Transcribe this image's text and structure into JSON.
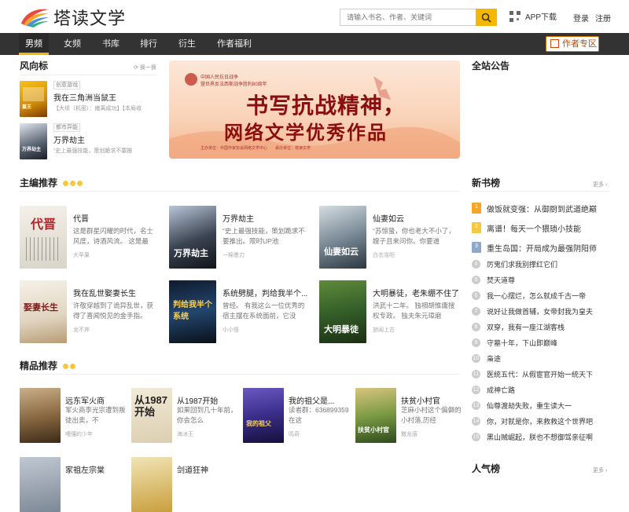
{
  "header": {
    "site_name": "塔读文学",
    "search_placeholder": "请输入书名、作者、关键词",
    "app_download": "APP下载",
    "login": "登录",
    "register": "注册"
  },
  "nav": {
    "items": [
      "男频",
      "女频",
      "书库",
      "排行",
      "衍生",
      "作者福利"
    ],
    "active_index": 0,
    "author_zone": "作者专区"
  },
  "trending": {
    "title": "风向标",
    "refresh": "换一换",
    "items": [
      {
        "tag": "创意游戏",
        "title": "我在三角洲当鼠王",
        "sub": "【大坝（机密）：撤离成功】【本局收"
      },
      {
        "tag": "都市异能",
        "title": "万界劫主",
        "sub": "“史上最强技能，策划跪求不要推"
      }
    ]
  },
  "banner": {
    "top_line1": "中国人民抗日战争",
    "top_line2": "暨世界反法西斯战争胜利80周年",
    "headline1": "书写抗战精神，",
    "headline2": "网络文学优秀作品",
    "footer": "主办单位：中国作家协会网络文学中心　　承办单位：塔读文学"
  },
  "editor_picks": {
    "title": "主编推荐",
    "books": [
      {
        "title": "代晋",
        "desc": "这是群星闪耀的时代，名士风度，诗酒风流。 这是最",
        "author": "大苹果"
      },
      {
        "title": "万界劫主",
        "desc": "“史上最强技能，策划跪求不要推出。限时UP池",
        "author": "一棉墨刀"
      },
      {
        "title": "仙妻如云",
        "desc": "“苏惊蛰，你也老大不小了，嫂子且来问你。你要道",
        "author": "白衣洛阳"
      },
      {
        "title": "我在乱世娶妻长生",
        "desc": "许敬穿越到了诡异乱世，获得了喜闻悦见的金手指。",
        "author": "龙不弃"
      },
      {
        "title": "系统劈腿，判给我半个...",
        "desc": "曾经。 有我这么一位优秀的宿主摆在系统面前，它没",
        "author": "小小怪"
      },
      {
        "title": "大明暴徒，老朱绷不住了",
        "desc": "洪武十二年。 独相胡惟庸搜权专政。 独夫朱元璋磨",
        "author": "旅闻上古"
      }
    ]
  },
  "quality_picks": {
    "title": "精品推荐",
    "books": [
      {
        "title": "远东军火商",
        "desc": "军火商李光宗遭到叛徒出卖，不",
        "author": "嘈懂的少年"
      },
      {
        "title": "从1987开始",
        "desc": "如果回到几十年前，你会怎么",
        "author": "海冰王"
      },
      {
        "title": "我的祖父是...",
        "desc": "读者群：636899359 在这",
        "author": "鸣奇"
      },
      {
        "title": "扶贫小村官",
        "desc": "芝麻小村这个偏僻的小村落,历经",
        "author": "撒龙唐"
      },
      {
        "title": "家祖左宗棠",
        "desc": "",
        "author": ""
      },
      {
        "title": "剑道狂神",
        "desc": "",
        "author": ""
      }
    ]
  },
  "announcements": {
    "title": "全站公告"
  },
  "new_books": {
    "title": "新书榜",
    "more": "更多",
    "items": [
      "做饭就变强：从御厨到武道绝巅",
      "离谱！每天一个猥琐小技能",
      "重生岛国：开局成为最强阴阳师",
      "厉鬼们求我别撑红它们",
      "焚天道尊",
      "我一心摆烂，怎么就成千古一帝",
      "说好让我做首辅，女帝封我为皇夫",
      "双穿，我有一座江湖客栈",
      "守墓十年，下山即巅峰",
      "枭途",
      "医统五代：从假宦官开始一统天下",
      "成神亡路",
      "仙尊渡劫失败，重生读大一",
      "你，对就是你，来救救这个世界吧",
      "黑山贼崛起，朕也不想御驾亲征啊"
    ]
  },
  "popular": {
    "title": "人气榜",
    "more": "更多"
  },
  "colors": {
    "accent": "#f5b800",
    "nav_bg": "#333333",
    "author_zone": "#c44a00"
  }
}
